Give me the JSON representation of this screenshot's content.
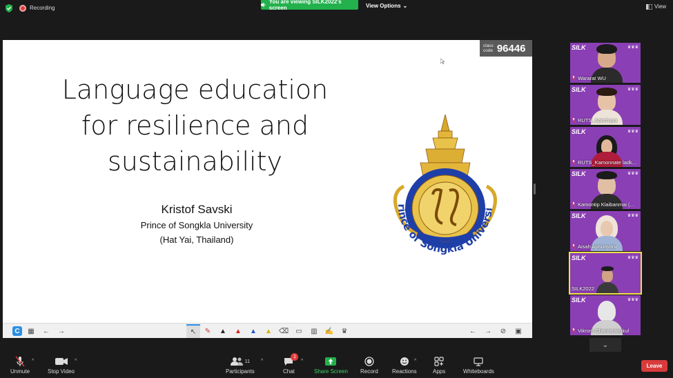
{
  "topbar": {
    "recording_label": "Recording",
    "viewing_banner": "You are viewing SILK2022's screen",
    "view_options": "View Options",
    "view_label": "View"
  },
  "slide": {
    "title_lines": [
      "Language education",
      "for resilience and",
      "sustainability"
    ],
    "author": "Kristof Savski",
    "affiliation": "Prince of Songkla University",
    "location": "(Hat Yai, Thailand)",
    "logo_text": "Prince of Songkla University",
    "class_code_label": "class code",
    "class_code_label_top": "class",
    "class_code_label_bottom": "code",
    "class_code": "96446"
  },
  "participants_gallery": [
    {
      "name": "Wararat WU",
      "skin": "#d7a98a",
      "shirt": "#2b2b2b",
      "active": false
    },
    {
      "name": "RUTS_Apitchaya",
      "skin": "#e6c3a8",
      "shirt": "#ede3d8",
      "active": false
    },
    {
      "name": "RUTS_Kamonnate ladk...",
      "skin": "#e2b89a",
      "shirt": "#b01c3b",
      "active": false
    },
    {
      "name": "Kamontip Klaibanmai (...",
      "skin": "#e0bfa2",
      "shirt": "#2c2c2c",
      "active": false
    },
    {
      "name": "Aisah Apridayani",
      "skin": "#e8c9b0",
      "shirt": "#9fb3d6",
      "active": false
    },
    {
      "name": "SILK2022",
      "skin": "#d1a283",
      "shirt": "#3a3a3a",
      "active": true
    },
    {
      "name": "Vikrom Chantarangkul",
      "skin": "#e7e7e7",
      "shirt": "#cfcfcf",
      "active": false
    }
  ],
  "bottombar": {
    "unmute": "Unmute",
    "stop_video": "Stop Video",
    "participants": "Participants",
    "participants_count": "11",
    "chat": "Chat",
    "chat_badge": "1",
    "share_screen": "Share Screen",
    "record": "Record",
    "reactions": "Reactions",
    "apps": "Apps",
    "whiteboards": "Whiteboards",
    "leave": "Leave"
  },
  "colors": {
    "banner_green": "#22b14c",
    "tile_purple": "#8b3fb5",
    "active_border": "#f0e24a",
    "leave_red": "#d93b3b",
    "logo_blue": "#1f3fa8",
    "logo_gold": "#d9a82a"
  }
}
